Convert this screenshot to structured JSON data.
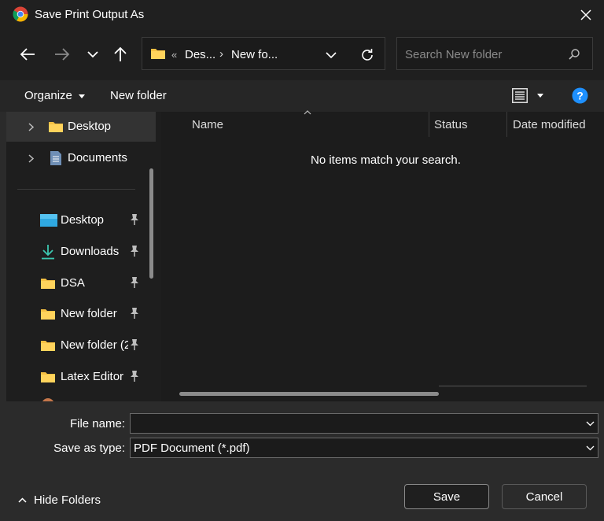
{
  "window": {
    "title": "Save Print Output As",
    "app_icon": "chrome-icon",
    "close_icon": "close-icon"
  },
  "nav": {
    "back_icon": "back-arrow-icon",
    "forward_icon": "forward-arrow-icon",
    "recent_icon": "chevron-down-icon",
    "up_icon": "up-arrow-icon",
    "address": {
      "overflow": "«",
      "segments": [
        "Des...",
        "New fo..."
      ],
      "separator": "›"
    },
    "refresh_icon": "refresh-icon",
    "search": {
      "placeholder": "Search New folder",
      "value": ""
    }
  },
  "commandbar": {
    "organize_label": "Organize",
    "new_folder_label": "New folder",
    "view_icon": "view-details-icon",
    "help_icon": "help-icon"
  },
  "sidebar": {
    "tree": [
      {
        "label": "Desktop",
        "icon": "folder-icon",
        "selected": true
      },
      {
        "label": "Documents",
        "icon": "document-icon"
      }
    ],
    "quick_access": [
      {
        "label": "Desktop",
        "icon": "desktop-icon"
      },
      {
        "label": "Downloads",
        "icon": "download-icon"
      },
      {
        "label": "DSA",
        "icon": "folder-icon"
      },
      {
        "label": "New folder",
        "icon": "folder-icon"
      },
      {
        "label": "New folder (2",
        "icon": "folder-icon"
      },
      {
        "label": "Latex Editor",
        "icon": "folder-icon"
      }
    ]
  },
  "filelist": {
    "columns": [
      "Name",
      "Status",
      "Date modified"
    ],
    "empty_message": "No items match your search."
  },
  "footer": {
    "file_name_label": "File name:",
    "file_name_value": "",
    "save_type_label": "Save as type:",
    "save_type_value": "PDF Document (*.pdf)",
    "hide_folders_label": "Hide Folders",
    "save_label": "Save",
    "cancel_label": "Cancel"
  },
  "colors": {
    "folder": "#f5c043",
    "accent_blue": "#1e90ff",
    "dialog_bg": "#2b2b2b"
  }
}
